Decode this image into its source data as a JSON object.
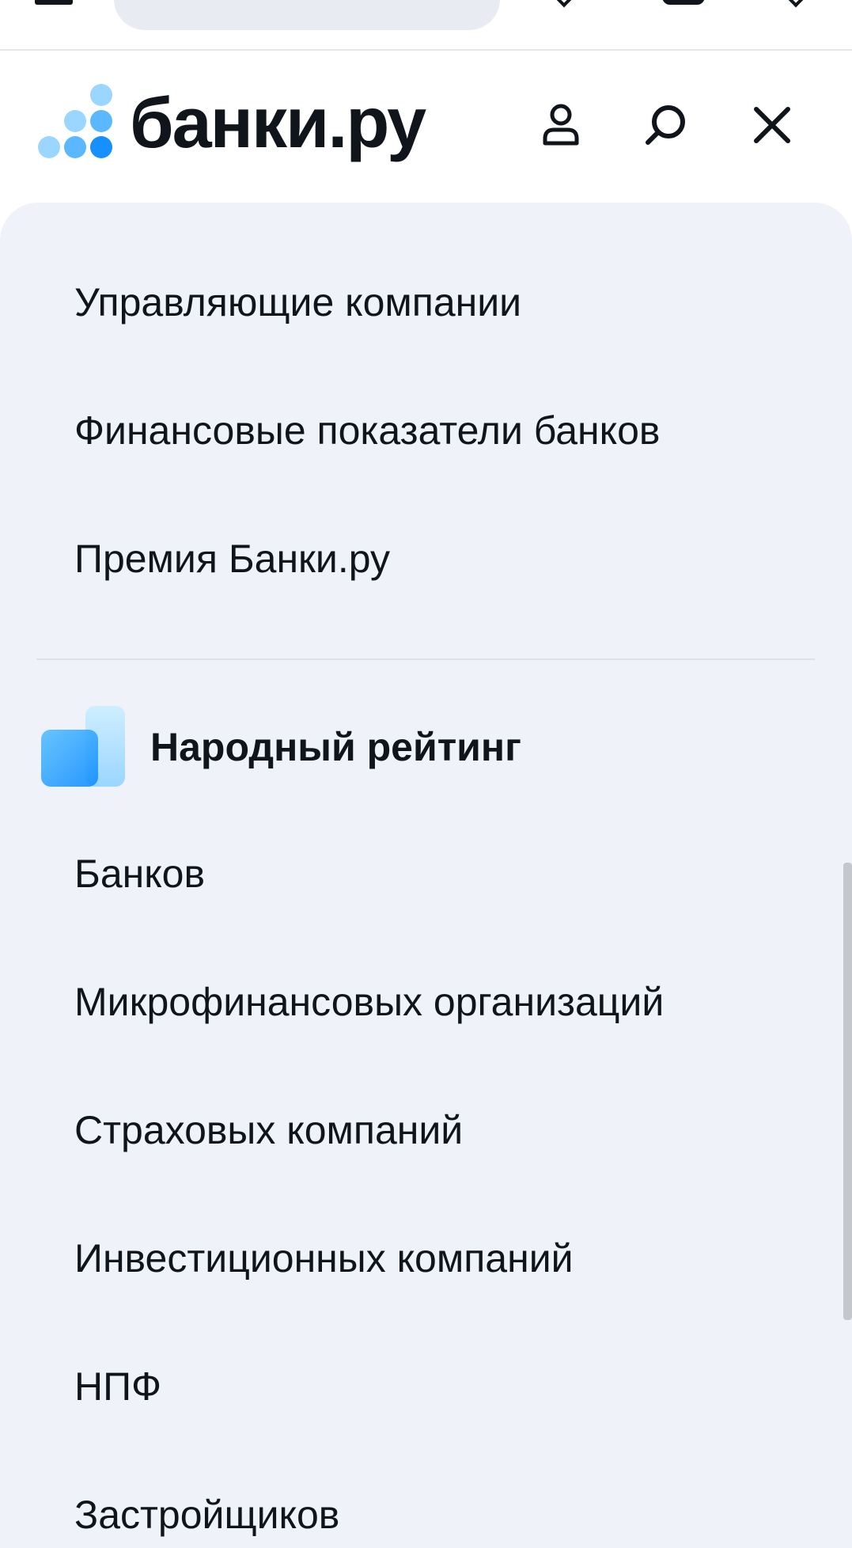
{
  "colors": {
    "accent": "#1a9bff",
    "panel_bg": "#eff2f8",
    "text": "#10151c",
    "logo_light": "#9ad6ff",
    "logo_mid": "#5bb8ff",
    "logo_dark": "#168fff"
  },
  "header": {
    "logo_text": "банки.ру",
    "profile_icon": "user-icon",
    "search_icon": "search-icon",
    "close_icon": "close-icon"
  },
  "menu": {
    "items_top": [
      {
        "label": "Управляющие компании"
      },
      {
        "label": "Финансовые показатели банков"
      },
      {
        "label": "Премия Банки.ру"
      }
    ],
    "section": {
      "title": "Народный рейтинг",
      "icon": "rating-bars-icon"
    },
    "items_section": [
      {
        "label": "Банков"
      },
      {
        "label": "Микрофинансовых организаций"
      },
      {
        "label": "Страховых компаний"
      },
      {
        "label": "Инвестиционных компаний"
      },
      {
        "label": "НПФ"
      },
      {
        "label": "Застройщиков"
      }
    ]
  }
}
